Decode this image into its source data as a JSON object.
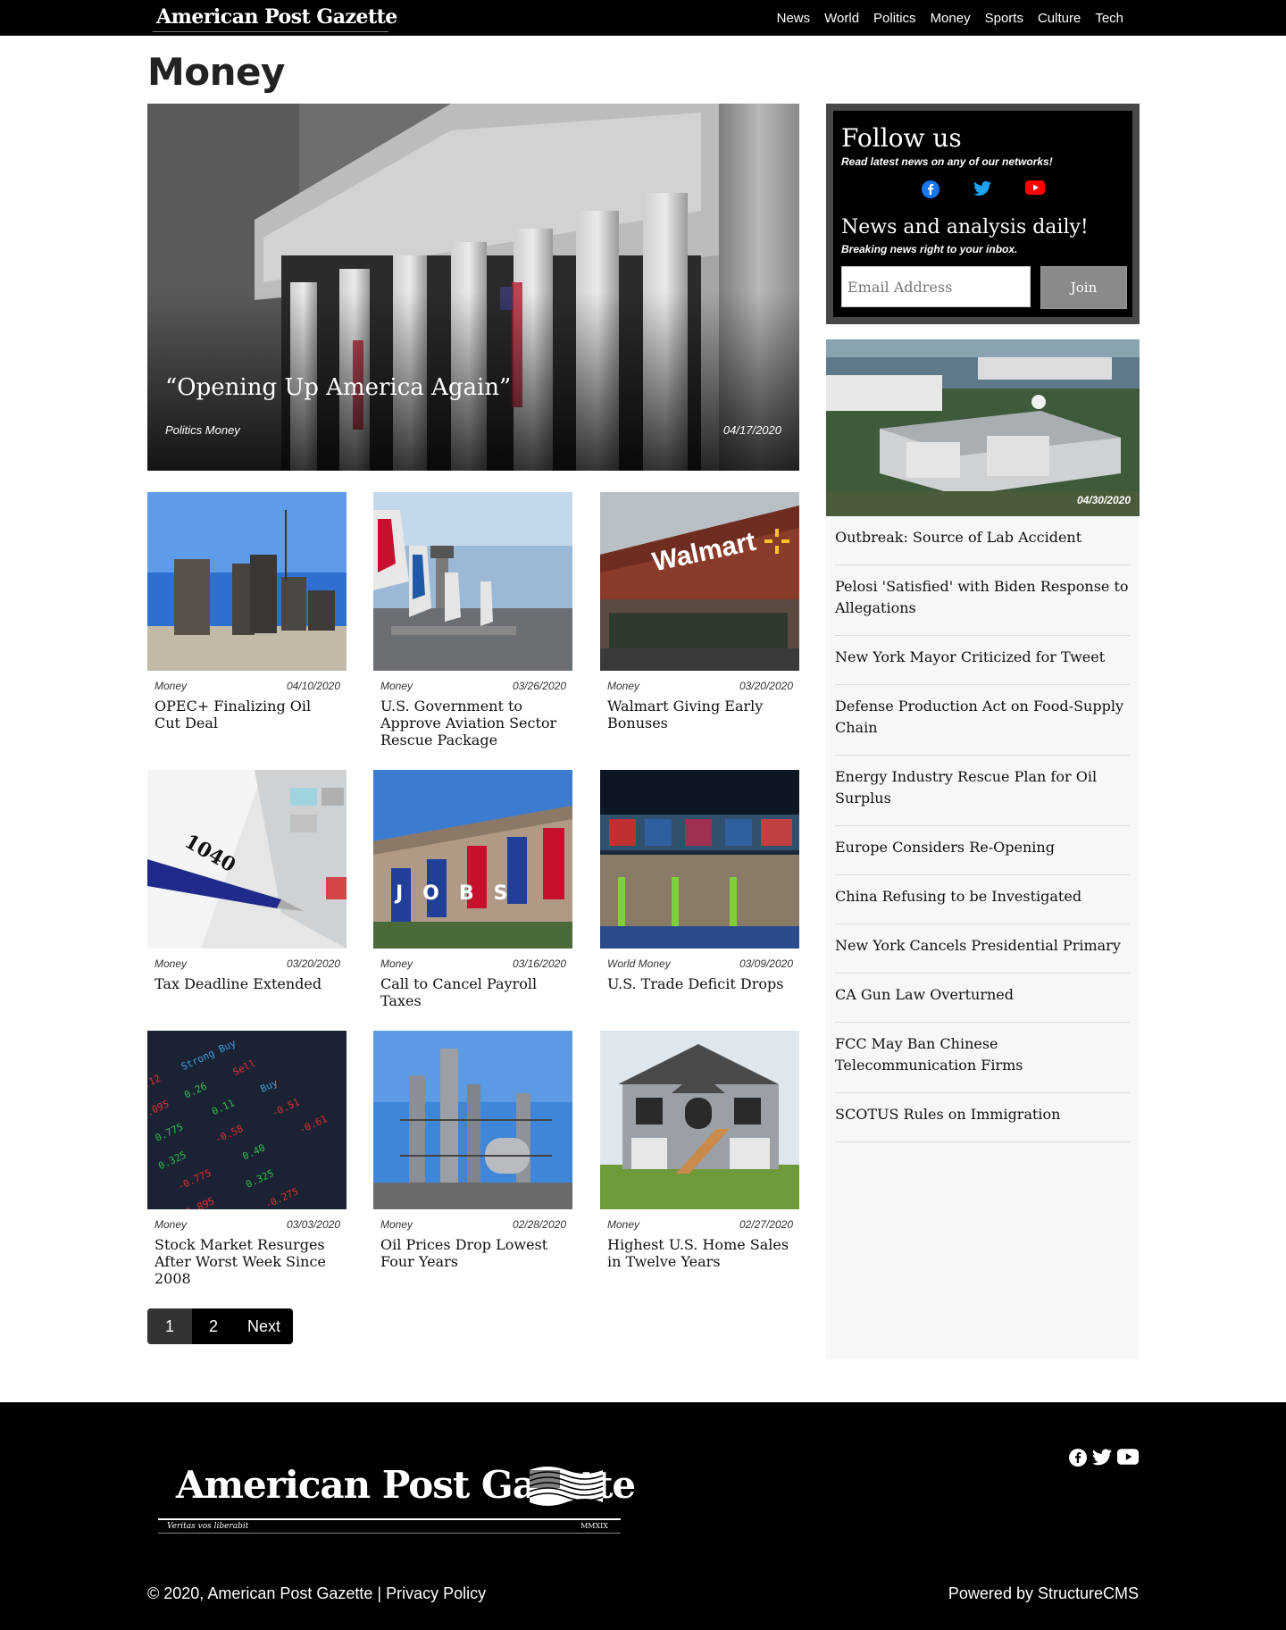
{
  "header": {
    "logo_text": "American Post Gazette",
    "nav": [
      "News",
      "World",
      "Politics",
      "Money",
      "Sports",
      "Culture",
      "Tech"
    ]
  },
  "page": {
    "title": "Money"
  },
  "hero": {
    "title": "“Opening Up America Again”",
    "category": "Politics Money",
    "date": "04/17/2020"
  },
  "articles": [
    {
      "category": "Money",
      "date": "04/10/2020",
      "title": "OPEC+ Finalizing Oil Cut Deal"
    },
    {
      "category": "Money",
      "date": "03/26/2020",
      "title": "U.S. Government to Approve Aviation Sector Rescue Package"
    },
    {
      "category": "Money",
      "date": "03/20/2020",
      "title": "Walmart Giving Early Bonuses"
    },
    {
      "category": "Money",
      "date": "03/20/2020",
      "title": "Tax Deadline Extended"
    },
    {
      "category": "Money",
      "date": "03/16/2020",
      "title": "Call to Cancel Payroll Taxes"
    },
    {
      "category": "World Money",
      "date": "03/09/2020",
      "title": "U.S. Trade Deficit Drops"
    },
    {
      "category": "Money",
      "date": "03/03/2020",
      "title": "Stock Market Resurges After Worst Week Since 2008"
    },
    {
      "category": "Money",
      "date": "02/28/2020",
      "title": "Oil Prices Drop Lowest Four Years"
    },
    {
      "category": "Money",
      "date": "02/27/2020",
      "title": "Highest U.S. Home Sales in Twelve Years"
    }
  ],
  "image_text": {
    "walmart_sign": "Walmart",
    "tax_form": "1040",
    "jobs_banner": "JOBS"
  },
  "pagination": {
    "page1": "1",
    "page2": "2",
    "next": "Next"
  },
  "sidebar": {
    "follow_title": "Follow us",
    "follow_sub": "Read latest news on any of our networks!",
    "newsletter_title": "News and analysis daily!",
    "newsletter_sub": "Breaking news right to your inbox.",
    "email_placeholder": "Email Address",
    "join_label": "Join",
    "feature_date": "04/30/2020",
    "headlines": [
      "Outbreak: Source of Lab Accident",
      "Pelosi 'Satisfied' with Biden Response to Allegations",
      "New York Mayor Criticized for Tweet",
      "Defense Production Act on Food-Supply Chain",
      "Energy Industry Rescue Plan for Oil Surplus",
      "Europe Considers Re-Opening",
      "China Refusing to be Investigated",
      "New York Cancels Presidential Primary",
      "CA Gun Law Overturned",
      "FCC May Ban Chinese Telecommunication Firms",
      "SCOTUS Rules on Immigration"
    ]
  },
  "footer": {
    "logo_text": "American Post Gazette",
    "motto": "Veritas vos liberabit",
    "year_mark": "MMXIX",
    "copyright": "© 2020, American Post Gazette | Privacy Policy",
    "powered": "Powered by StructureCMS"
  },
  "colors": {
    "facebook": "#1877f2",
    "twitter": "#1da1f2",
    "youtube": "#ff0000",
    "header_bg": "#000000",
    "sidebar_bg": "#f6f7f8"
  }
}
